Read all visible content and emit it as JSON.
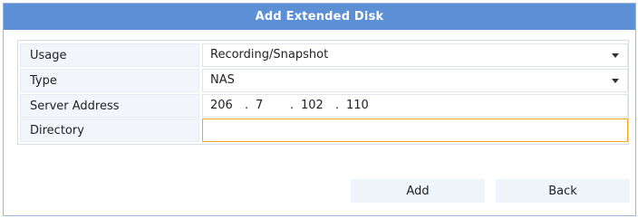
{
  "dialog": {
    "title": "Add Extended Disk"
  },
  "form": {
    "usage": {
      "label": "Usage",
      "value": "Recording/Snapshot"
    },
    "type": {
      "label": "Type",
      "value": "NAS"
    },
    "server_address": {
      "label": "Server Address",
      "octets": [
        "206",
        "7",
        "102",
        "110"
      ]
    },
    "directory": {
      "label": "Directory",
      "value": ""
    }
  },
  "buttons": {
    "add": "Add",
    "back": "Back"
  },
  "colors": {
    "titlebar": "#5b8fd6",
    "focus_border": "#f0a91e"
  }
}
